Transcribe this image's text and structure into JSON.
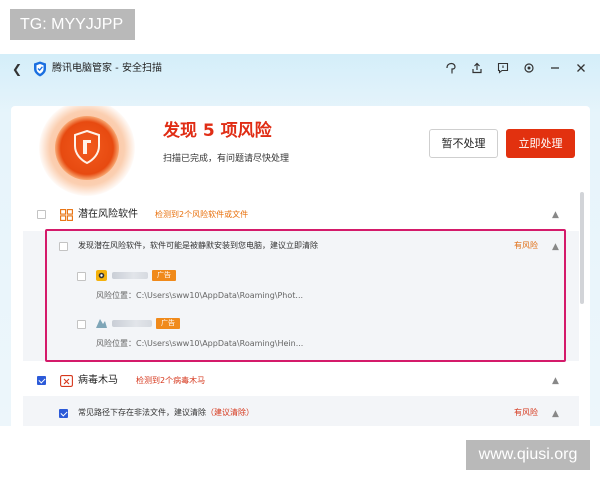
{
  "watermarks": {
    "top": "TG: MYYJJPP",
    "bottom": "www.qiusi.org"
  },
  "window": {
    "title": "腾讯电脑管家 - 安全扫描",
    "back_icon": "chevron-left-icon",
    "toolbar_icons": [
      "skin-icon",
      "share-icon",
      "feedback-icon",
      "settings-icon",
      "minimize-icon",
      "close-icon"
    ]
  },
  "summary": {
    "prefix": "发现 ",
    "count": "5",
    "suffix": " 项风险",
    "subtitle": "扫描已完成，有问题请尽快处理",
    "ignore_label": "暂不处理",
    "fix_label": "立即处理"
  },
  "categories": [
    {
      "title": "潜在风险软件",
      "note": "检测到2个风险软件或文件",
      "checked": false,
      "item": {
        "text": "发现潜在风险软件，软件可能是被静默安装到您电脑，建议立即清除",
        "risk": "有风险",
        "entries": [
          {
            "badge": "广告",
            "path_label": "风险位置：",
            "path": "C:\\Users\\sww10\\AppData\\Roaming\\Phot..."
          },
          {
            "badge": "广告",
            "path_label": "风险位置：",
            "path": "C:\\Users\\sww10\\AppData\\Roaming\\Hein..."
          }
        ]
      }
    },
    {
      "title": "病毒木马",
      "note": "检测到2个病毒木马",
      "checked": true,
      "item": {
        "text": "常见路径下存在非法文件，建议清除",
        "suggest": "（建议清除）",
        "risk": "有风险"
      }
    }
  ],
  "colors": {
    "accent_red": "#e2310f",
    "warning_orange": "#e8700c",
    "highlight_border": "#d41a6a",
    "checkbox_blue": "#2c5ad8"
  }
}
